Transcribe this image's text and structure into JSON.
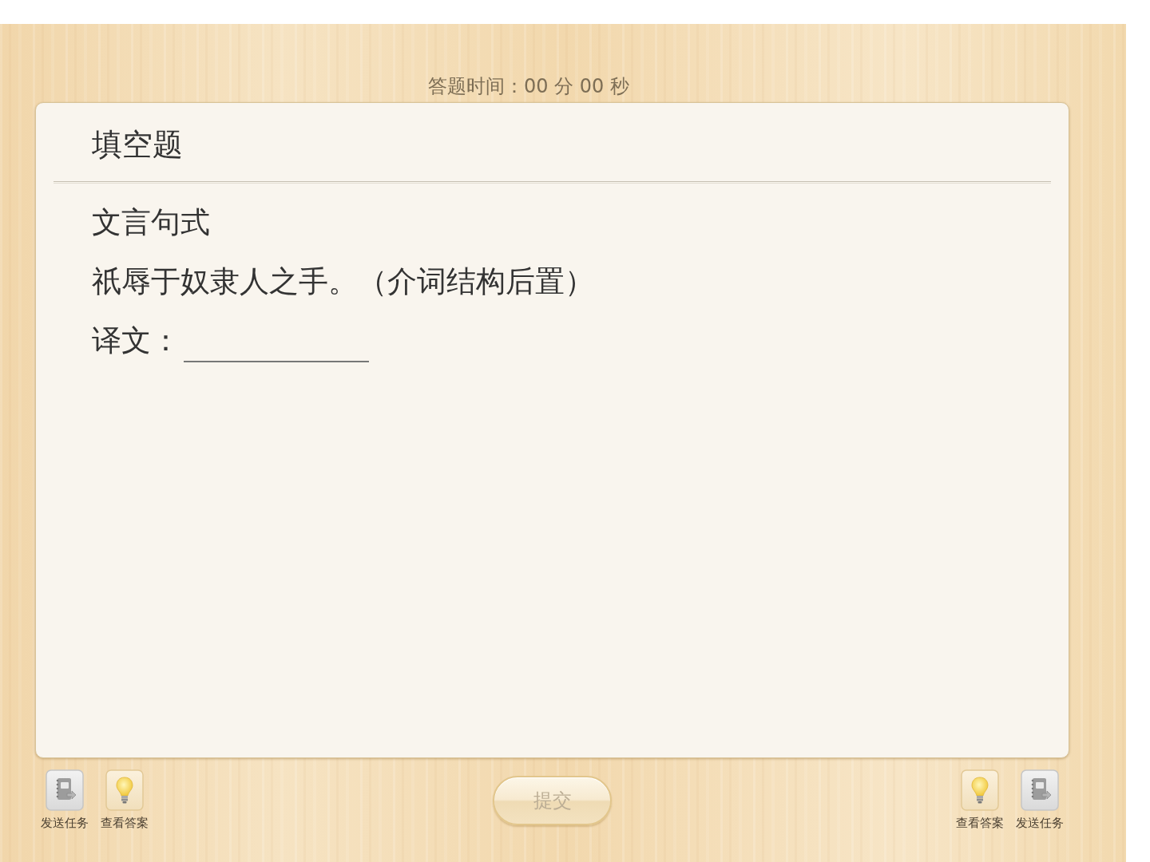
{
  "timer": "答题时间：00 分 00 秒",
  "question": {
    "type_title": "填空题",
    "lines": [
      {
        "kind": "text",
        "text": "文言句式"
      },
      {
        "kind": "text",
        "text": "祇辱于奴隶人之手。（介词结构后置）"
      },
      {
        "kind": "blank",
        "label": "译文："
      }
    ]
  },
  "left_tools": [
    {
      "kind": "send",
      "label": "发送任务"
    },
    {
      "kind": "answer",
      "label": "查看答案"
    }
  ],
  "submit": {
    "label": "提交",
    "disabled": true
  },
  "right_tools": [
    {
      "kind": "answer",
      "label": "查看答案"
    },
    {
      "kind": "send",
      "label": "发送任务"
    }
  ]
}
